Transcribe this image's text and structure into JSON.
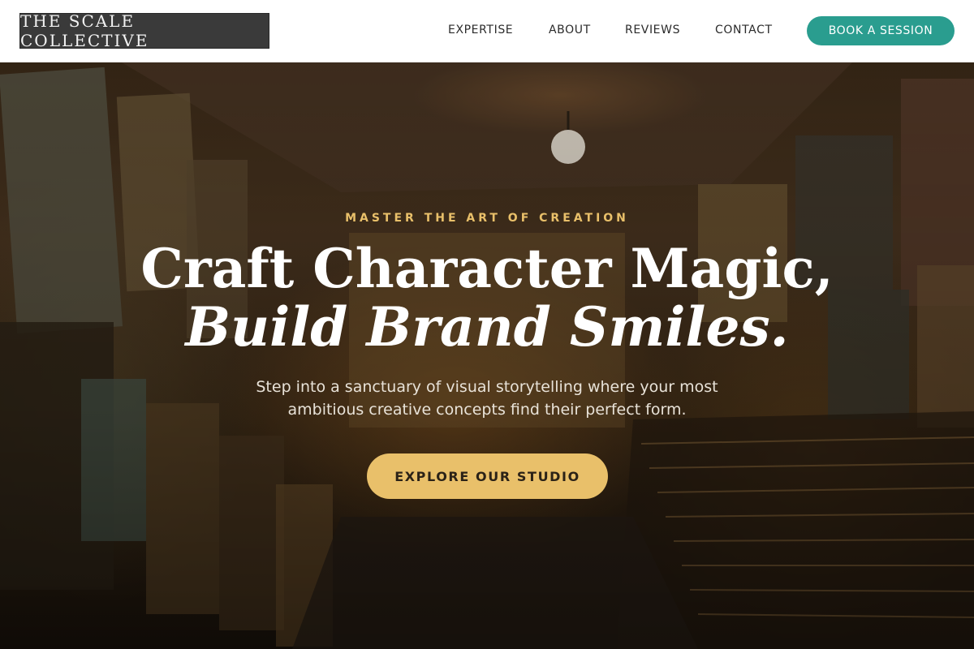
{
  "header": {
    "logo_text": "THE SCALE COLLECTIVE",
    "nav": [
      {
        "label": "EXPERTISE"
      },
      {
        "label": "ABOUT"
      },
      {
        "label": "REVIEWS"
      },
      {
        "label": "CONTACT"
      }
    ],
    "cta_label": "BOOK A SESSION"
  },
  "hero": {
    "eyebrow": "MASTER THE ART OF CREATION",
    "headline_line1": "Craft Character Magic,",
    "headline_line2": "Build Brand Smiles.",
    "subtext": "Step into a sanctuary of visual storytelling where your most ambitious creative concepts find their perfect form.",
    "cta_label": "EXPLORE OUR STUDIO"
  },
  "colors": {
    "accent_teal": "#2a9d8f",
    "accent_gold": "#e9c06a",
    "logo_bg": "#3a3a3a"
  }
}
